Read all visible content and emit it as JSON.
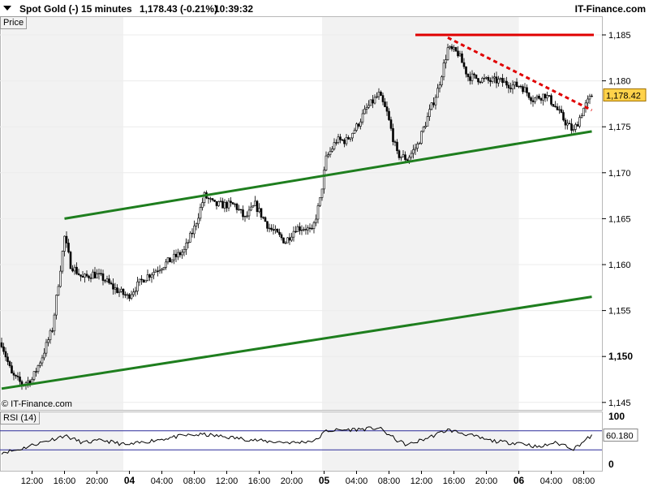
{
  "header": {
    "instrument": "Spot Gold (-)",
    "interval": "15 minutes",
    "quote": "1,178.43 (-0.21%)",
    "time": "10:39:32",
    "brand": "IT-Finance.com"
  },
  "price_panel_label": "Price",
  "rsi_panel_label": "RSI (14)",
  "copyright": "© IT-Finance.com",
  "colors": {
    "support_lines": "#1e7e1e",
    "resistance_line": "#e00000",
    "dashed_trendline": "#e00000",
    "candle_up": "#ffffff",
    "candle_down": "#000000",
    "session_shade": "#f2f2f2",
    "price_tag": "#ffd24a"
  },
  "chart_data": [
    {
      "type": "candlestick",
      "panel": "price",
      "ylim": [
        1144,
        1187
      ],
      "ytick_labels": [
        "1,185",
        "1,180",
        "1,175",
        "1,170",
        "1,165",
        "1,160",
        "1,155",
        "1,150",
        "1,145"
      ],
      "ytick_values": [
        1185,
        1180,
        1175,
        1170,
        1165,
        1160,
        1155,
        1150,
        1145
      ],
      "bold_tick": "1,150",
      "x_count": 365,
      "xtick_labels": [
        {
          "i": 15,
          "label": "12:00",
          "bold": false
        },
        {
          "i": 31,
          "label": "16:00",
          "bold": false
        },
        {
          "i": 47,
          "label": "20:00",
          "bold": false
        },
        {
          "i": 63,
          "label": "04",
          "bold": true
        },
        {
          "i": 79,
          "label": "04:00",
          "bold": false
        },
        {
          "i": 95,
          "label": "08:00",
          "bold": false
        },
        {
          "i": 111,
          "label": "12:00",
          "bold": false
        },
        {
          "i": 127,
          "label": "16:00",
          "bold": false
        },
        {
          "i": 143,
          "label": "20:00",
          "bold": false
        },
        {
          "i": 159,
          "label": "05",
          "bold": true
        },
        {
          "i": 175,
          "label": "04:00",
          "bold": false
        },
        {
          "i": 191,
          "label": "08:00",
          "bold": false
        },
        {
          "i": 207,
          "label": "12:00",
          "bold": false
        },
        {
          "i": 223,
          "label": "16:00",
          "bold": false
        },
        {
          "i": 239,
          "label": "20:00",
          "bold": false
        },
        {
          "i": 255,
          "label": "06",
          "bold": true
        },
        {
          "i": 271,
          "label": "04:00",
          "bold": false
        },
        {
          "i": 287,
          "label": "08:00",
          "bold": false
        }
      ],
      "shaded_sessions": [
        [
          0,
          60
        ],
        [
          158,
          255
        ]
      ],
      "price_waypoints": [
        [
          0,
          1151.5
        ],
        [
          5,
          1148.0
        ],
        [
          10,
          1147.0
        ],
        [
          15,
          1147.5
        ],
        [
          20,
          1150.0
        ],
        [
          25,
          1153.0
        ],
        [
          28,
          1158.0
        ],
        [
          31,
          1163.0
        ],
        [
          34,
          1160.0
        ],
        [
          40,
          1158.5
        ],
        [
          45,
          1159.0
        ],
        [
          50,
          1158.5
        ],
        [
          55,
          1157.5
        ],
        [
          62,
          1156.5
        ],
        [
          70,
          1158.5
        ],
        [
          80,
          1160.0
        ],
        [
          90,
          1161.5
        ],
        [
          95,
          1164.0
        ],
        [
          100,
          1167.5
        ],
        [
          105,
          1166.5
        ],
        [
          115,
          1166.5
        ],
        [
          120,
          1165.0
        ],
        [
          125,
          1166.5
        ],
        [
          132,
          1164.0
        ],
        [
          140,
          1162.5
        ],
        [
          145,
          1164.0
        ],
        [
          150,
          1164.0
        ],
        [
          153,
          1163.5
        ],
        [
          157,
          1167.0
        ],
        [
          160,
          1171.5
        ],
        [
          165,
          1173.5
        ],
        [
          170,
          1173.5
        ],
        [
          175,
          1175.0
        ],
        [
          180,
          1177.0
        ],
        [
          186,
          1178.5
        ],
        [
          190,
          1176.5
        ],
        [
          195,
          1172.0
        ],
        [
          200,
          1171.5
        ],
        [
          205,
          1173.0
        ],
        [
          210,
          1176.0
        ],
        [
          215,
          1179.0
        ],
        [
          220,
          1183.5
        ],
        [
          225,
          1183.0
        ],
        [
          230,
          1180.5
        ],
        [
          240,
          1180.0
        ],
        [
          245,
          1180.0
        ],
        [
          252,
          1179.5
        ],
        [
          256,
          1179.5
        ],
        [
          262,
          1178.0
        ],
        [
          268,
          1178.5
        ],
        [
          272,
          1177.5
        ],
        [
          278,
          1175.5
        ],
        [
          282,
          1174.5
        ],
        [
          287,
          1177.0
        ],
        [
          291,
          1178.4
        ]
      ],
      "trendlines": [
        {
          "name": "resistance",
          "style": "solid",
          "color": "#e00000",
          "from": [
            204,
            1185.0
          ],
          "to": [
            292,
            1185.0
          ]
        },
        {
          "name": "descending",
          "style": "dashed",
          "color": "#e00000",
          "from": [
            220,
            1184.7
          ],
          "to": [
            291,
            1176.8
          ]
        },
        {
          "name": "upper-channel",
          "style": "solid",
          "color": "#1e7e1e",
          "from": [
            31,
            1165.0
          ],
          "to": [
            291,
            1174.5
          ]
        },
        {
          "name": "lower-channel",
          "style": "solid",
          "color": "#1e7e1e",
          "from": [
            0,
            1146.5
          ],
          "to": [
            291,
            1156.5
          ]
        }
      ],
      "last_value_label": "1,178.42",
      "last_value": 1178.42
    },
    {
      "type": "line",
      "panel": "rsi",
      "name": "RSI (14)",
      "ylim": [
        0,
        100
      ],
      "ytick_labels": [
        "100",
        "0"
      ],
      "ytick_values": [
        100,
        0
      ],
      "levels": [
        70,
        30
      ],
      "last_value_label": "60.180",
      "last_value": 60.18,
      "rsi_waypoints": [
        [
          0,
          25
        ],
        [
          8,
          30
        ],
        [
          15,
          40
        ],
        [
          25,
          52
        ],
        [
          31,
          60
        ],
        [
          40,
          45
        ],
        [
          50,
          50
        ],
        [
          62,
          40
        ],
        [
          75,
          50
        ],
        [
          90,
          60
        ],
        [
          100,
          62
        ],
        [
          115,
          55
        ],
        [
          130,
          48
        ],
        [
          145,
          45
        ],
        [
          155,
          50
        ],
        [
          160,
          70
        ],
        [
          170,
          72
        ],
        [
          180,
          74
        ],
        [
          186,
          76
        ],
        [
          195,
          50
        ],
        [
          200,
          40
        ],
        [
          210,
          55
        ],
        [
          220,
          72
        ],
        [
          230,
          62
        ],
        [
          240,
          50
        ],
        [
          250,
          45
        ],
        [
          256,
          45
        ],
        [
          265,
          35
        ],
        [
          272,
          45
        ],
        [
          278,
          40
        ],
        [
          282,
          32
        ],
        [
          287,
          48
        ],
        [
          291,
          60
        ]
      ]
    }
  ]
}
